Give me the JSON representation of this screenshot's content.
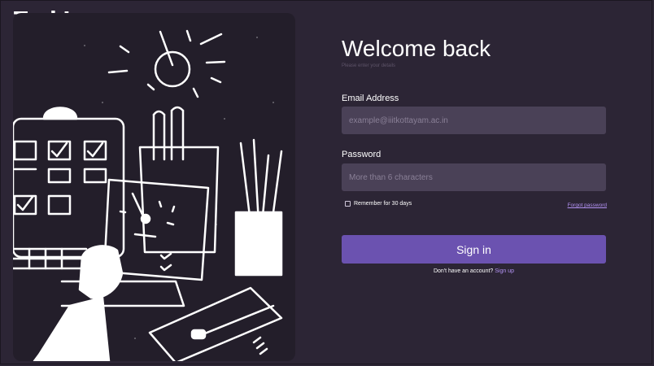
{
  "brand": {
    "name": "TaskLoop"
  },
  "form": {
    "title": "Welcome back",
    "subtitle": "Please enter your details",
    "email_label": "Email Address",
    "email_placeholder": "example@iiitkottayam.ac.in",
    "email_value": "",
    "password_label": "Password",
    "password_placeholder": "More than 6 characters",
    "password_value": "",
    "remember_label": "Remember for 30 days",
    "remember_checked": false,
    "forgot_label": "Forgot password",
    "signin_label": "Sign in",
    "signup_prompt": "Don't have an account?",
    "signup_link": "Sign up"
  },
  "illustration": {
    "icon": "desk-workspace-illustration"
  },
  "colors": {
    "background": "#2c2535",
    "panel": "#231e2a",
    "input": "#4a4157",
    "accent": "#6b52b0",
    "link": "#b292f2"
  }
}
